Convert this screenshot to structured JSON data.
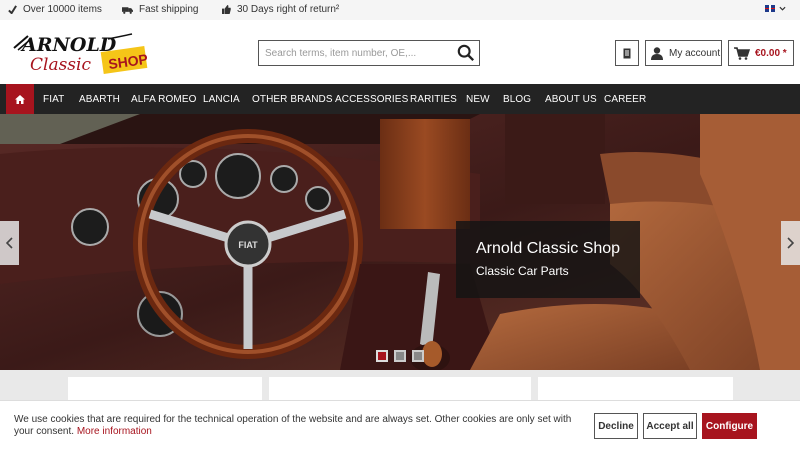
{
  "topbar": {
    "usps": [
      {
        "label": "Over 10000 items",
        "icon": "check-icon"
      },
      {
        "label": "Fast shipping",
        "icon": "truck-icon"
      },
      {
        "label": "30 Days right of return²",
        "icon": "thumbs-up-icon"
      }
    ],
    "language": {
      "icon": "uk-flag-icon"
    }
  },
  "header": {
    "logo": {
      "line1": "ARNOLD",
      "line2": "Classic",
      "badge": "SHOP"
    },
    "search": {
      "placeholder": "Search terms, item number, OE,..."
    },
    "account_label": "My account",
    "cart_total": "€0.00 *"
  },
  "nav": {
    "home_icon": "home-icon",
    "items": [
      "FIAT",
      "ABARTH",
      "ALFA ROMEO",
      "LANCIA",
      "OTHER BRANDS",
      "ACCESSORIES",
      "RARITIES",
      "NEW",
      "BLOG",
      "ABOUT US",
      "CAREER"
    ]
  },
  "hero": {
    "title": "Arnold Classic Shop",
    "subtitle": "Classic Car Parts",
    "steering_wheel_badge": "FIAT",
    "slides": 3,
    "active_slide": 1
  },
  "cookie": {
    "message": "We use cookies that are required for the technical operation of the website and are always set. Other cookies are only set with your consent.",
    "more_link": "More information",
    "decline": "Decline",
    "accept_all": "Accept all",
    "configure": "Configure"
  },
  "colors": {
    "brand_red": "#a7141e",
    "nav_background": "#232323",
    "logo_yellow": "#f5c518"
  }
}
